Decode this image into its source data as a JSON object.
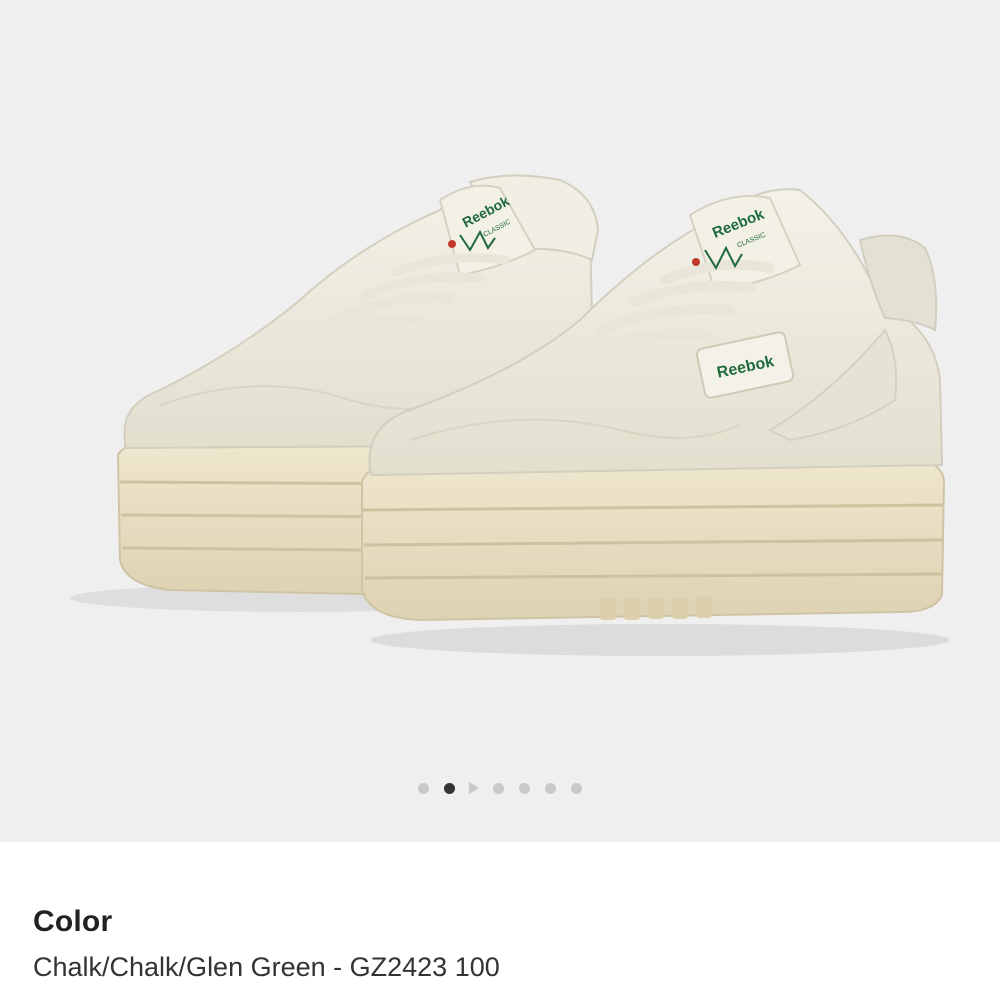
{
  "product_image": {
    "alt": "Reebok Club C Extra platform sneakers",
    "brand_tongue": "Reebok",
    "brand_tongue_sub": "CLASSIC",
    "side_tab": "Reebok",
    "colors": {
      "background": "#efeff0",
      "upper": "#ece9dc",
      "sole": "#e8dfc4",
      "accent_green": "#1f6b3c",
      "accent_red": "#c0392b"
    }
  },
  "pager": {
    "active_index": 1,
    "count": 7
  },
  "details": {
    "color_heading": "Color",
    "color_value": "Chalk/Chalk/Glen Green - GZ2423 100"
  }
}
